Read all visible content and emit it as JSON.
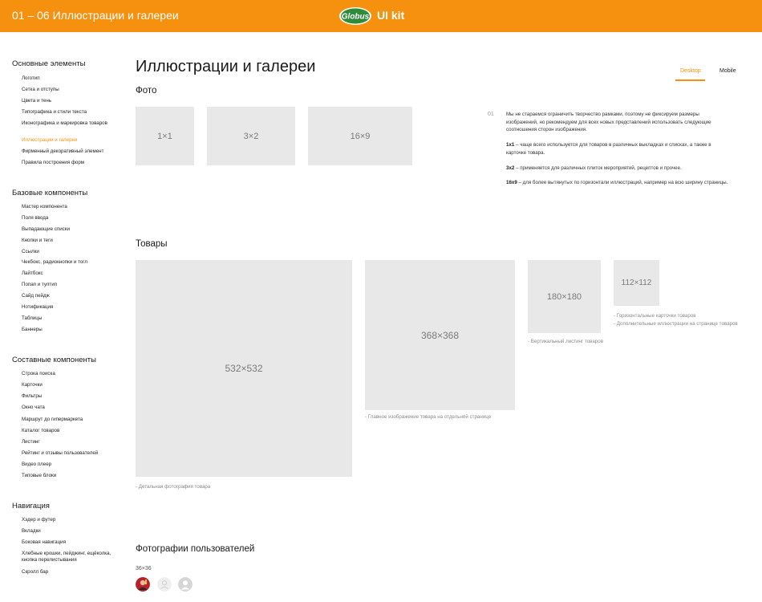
{
  "header": {
    "page_code": "01 – 06 Иллюстрации и галереи",
    "logo_text": "Globus",
    "logo_kit": "UI kit",
    "colors": {
      "accent": "#f5910f",
      "logo_green": "#2e8b3a"
    }
  },
  "sidebar": {
    "groups": [
      {
        "title": "Основные элементы",
        "items": [
          "Логотип",
          "Сетка и отступы",
          "Цвета и тень",
          "Типографика и стили текста",
          "Иконографика и маркировка товаров",
          "Иллюстрации и галереи",
          "Фирменный декоративный элемент",
          "Правила построения форм"
        ]
      },
      {
        "title": "Базовые компоненты",
        "items": [
          "Мастер компонента",
          "Поля ввода",
          "Выпадающие списки",
          "Кнопки и теги",
          "Ссылки",
          "Чекбокс, радиокнопки и тогл",
          "Лайтбокс",
          "Попап и тултип",
          "Сайд пейдж",
          "Нотификация",
          "Таблицы",
          "Баннеры"
        ]
      },
      {
        "title": "Составные компоненты",
        "items": [
          "Строка поиска",
          "Карточки",
          "Фильтры",
          "Окно чата",
          "Маршрут до гипермаркета",
          "Каталог товаров",
          "Листинг",
          "Рейтинг и отзывы пользователей",
          "Видео плеер",
          "Типовые блоки"
        ]
      },
      {
        "title": "Навигация",
        "items": [
          "Хэдер и футер",
          "Вкладки",
          "Боковая навигация",
          "Хлебные крошки, пейджинг, ещёколка, кнопка перелистывания",
          "Скролл бар"
        ]
      }
    ],
    "active_item": "Иллюстрации и галереи"
  },
  "main": {
    "title": "Иллюстрации и галереи",
    "tabs": [
      {
        "label": "Desktop",
        "active": true
      },
      {
        "label": "Mobile",
        "active": false
      }
    ],
    "photo": {
      "title": "Фото",
      "placeholders": [
        "1×1",
        "3×2",
        "16×9"
      ],
      "note_number": "01",
      "note_intro": "Мы не стараемся ограничить творчество рамками, поэтому не фиксируем размеры изображений, но рекомендуем для всех новых представлений использовать следующие соотношения сторон изображения.",
      "ratios": [
        {
          "key": "1x1",
          "text": " – чаще всего используется для товаров в различных выкладках и списках, а также в карточке товара."
        },
        {
          "key": "3x2",
          "text": " – применяется для различных плиток мероприятий, рецептов и прочее."
        },
        {
          "key": "16x9",
          "text": " – для более вытянутых по горизонтали иллюстраций, например на всю ширину страницы."
        }
      ]
    },
    "products": {
      "title": "Товары",
      "items": [
        {
          "size": "532×532",
          "caption": "- Детальная фотография товара"
        },
        {
          "size": "368×368",
          "caption": "- Главное изображение товара на отдельной странице"
        },
        {
          "size": "180×180",
          "caption": "- Вертикальный листинг товаров"
        },
        {
          "size": "112×112",
          "caption": "- Горизонтальные карточки товаров",
          "caption2": "- Дополнительные иллюстрации на странице товаров"
        }
      ]
    },
    "users": {
      "title": "Фотографии пользователей",
      "size_label": "36×36",
      "avatars": [
        "photo",
        "placeholder-light",
        "placeholder-dark"
      ]
    }
  }
}
